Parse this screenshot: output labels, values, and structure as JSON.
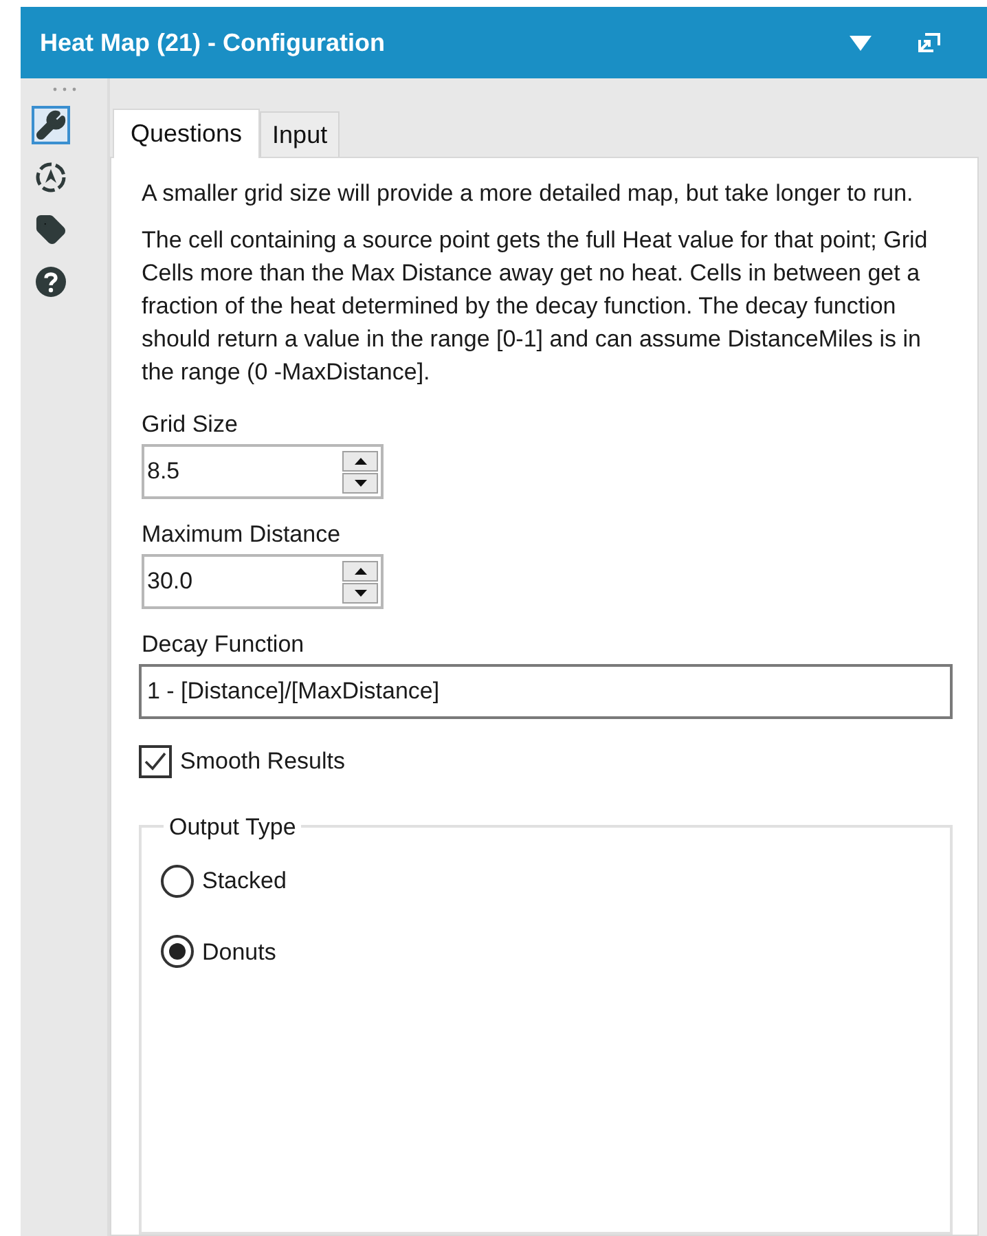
{
  "window": {
    "title": "Heat Map (21) - Configuration"
  },
  "sidebar": {
    "items": [
      {
        "kind": "wrench",
        "selected": true
      },
      {
        "kind": "compass",
        "selected": false
      },
      {
        "kind": "tag",
        "selected": false
      },
      {
        "kind": "help",
        "selected": false
      }
    ]
  },
  "tabs": [
    {
      "label": "Questions",
      "selected": true
    },
    {
      "label": "Input",
      "selected": false
    }
  ],
  "paragraphs": [
    "A smaller grid size will provide a more detailed map, but take longer to run.",
    "The cell containing a source point gets the full Heat value for that point; Grid Cells more than the Max Distance away get no heat.  Cells in between get a fraction of the heat determined by the decay function.  The decay function should return a value in the range [0-1] and can assume DistanceMiles is in the range (0 -MaxDistance]."
  ],
  "grid_size": {
    "label": "Grid Size",
    "value": "8.5"
  },
  "maximum_distance": {
    "label": "Maximum Distance",
    "value": "30.0"
  },
  "decay_function": {
    "label": "Decay Function",
    "value": "1 - [Distance]/[MaxDistance]"
  },
  "smooth_results": {
    "label": "Smooth Results",
    "checked": true
  },
  "output_type": {
    "label": "Output Type",
    "options": [
      {
        "label": "Stacked",
        "selected": false
      },
      {
        "label": "Donuts",
        "selected": true
      }
    ]
  }
}
